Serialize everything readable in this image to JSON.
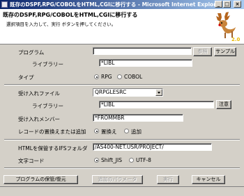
{
  "window": {
    "title": "既存のDSPF,RPG/COBOLをHTML,CGIに移行する - Microsoft Internet Explorer",
    "controls": [
      "_",
      "□",
      "×"
    ]
  },
  "header": {
    "title": "既存のDSPF,RPG/COBOLをHTML,CGIに移行する",
    "subtitle": "選択項目を入力して、実行 ボタンを押してください。",
    "logo_icon": "reindeer-logo-icon",
    "logo_text": "2.0"
  },
  "program": {
    "label": "プログラム",
    "value": "",
    "browse_label": "参照",
    "sample_label": "サンプル",
    "library_label": "ライブラリー",
    "library_value": "*LIBL",
    "type_label": "タイプ",
    "type_options": [
      "RPG",
      "COBOL"
    ],
    "type_selected": "RPG"
  },
  "receive": {
    "file_label": "受け入れファイル",
    "file_value": "QRPGLESRC",
    "library_label": "ライブラリー",
    "library_value": "*LIBL",
    "note_label": "注意",
    "member_label": "受け入れメンバー",
    "member_value": "*FROMMBR",
    "replace_label": "レコードの置換えまたは追加",
    "replace_options": [
      "置換え",
      "追加"
    ],
    "replace_selected": "置換え"
  },
  "output": {
    "folder_label": "HTMLを保管するIFSフォルダ",
    "folder_value": "/AS400-NET.USR/PROJECT/",
    "charset_label": "文字コード",
    "charset_options": [
      "Shift_JIS",
      "UTF-8"
    ],
    "charset_selected": "Shift_JIS"
  },
  "footer": {
    "save_label": "プログラムの保管/復元",
    "params_label": "追加のパラメータ",
    "run_label": "実行",
    "cancel_label": "キャンセル"
  }
}
